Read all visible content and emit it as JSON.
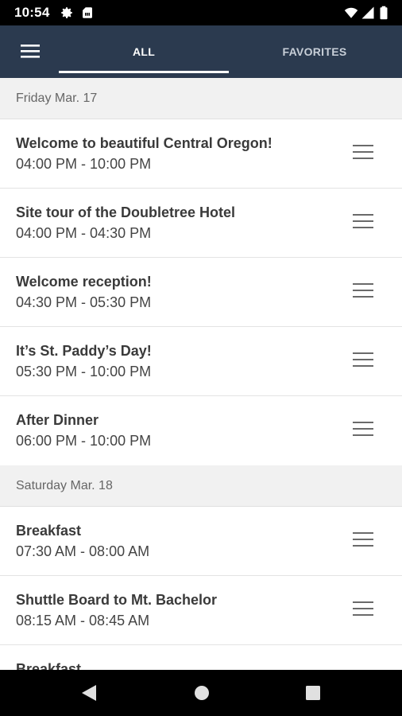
{
  "status_bar": {
    "time": "10:54",
    "icons": [
      "gear-icon",
      "sim-card-icon",
      "wifi-icon",
      "signal-icon",
      "battery-icon"
    ]
  },
  "app_bar": {
    "tabs": [
      {
        "label": "ALL",
        "selected": true
      },
      {
        "label": "FAVORITES",
        "selected": false
      }
    ],
    "colors": {
      "background": "#2b3a4f",
      "indicator": "#ffffff"
    }
  },
  "schedule": [
    {
      "day": "Friday Mar. 17",
      "events": [
        {
          "title": "Welcome to beautiful Central Oregon!",
          "time": "04:00 PM - 10:00 PM"
        },
        {
          "title": "Site tour of the Doubletree Hotel",
          "time": "04:00 PM - 04:30 PM"
        },
        {
          "title": "Welcome reception!",
          "time": "04:30 PM - 05:30 PM"
        },
        {
          "title": "It’s St. Paddy’s Day!",
          "time": "05:30 PM - 10:00 PM"
        },
        {
          "title": "After Dinner",
          "time": "06:00 PM - 10:00 PM"
        }
      ]
    },
    {
      "day": "Saturday Mar. 18",
      "events": [
        {
          "title": "Breakfast",
          "time": "07:30 AM - 08:00 AM"
        },
        {
          "title": "Shuttle Board to Mt. Bachelor",
          "time": "08:15 AM - 08:45 AM"
        },
        {
          "title": "Breakfast",
          "time": ""
        }
      ]
    }
  ],
  "nav_bar": {
    "buttons": [
      "back-icon",
      "home-icon",
      "recents-icon"
    ]
  }
}
